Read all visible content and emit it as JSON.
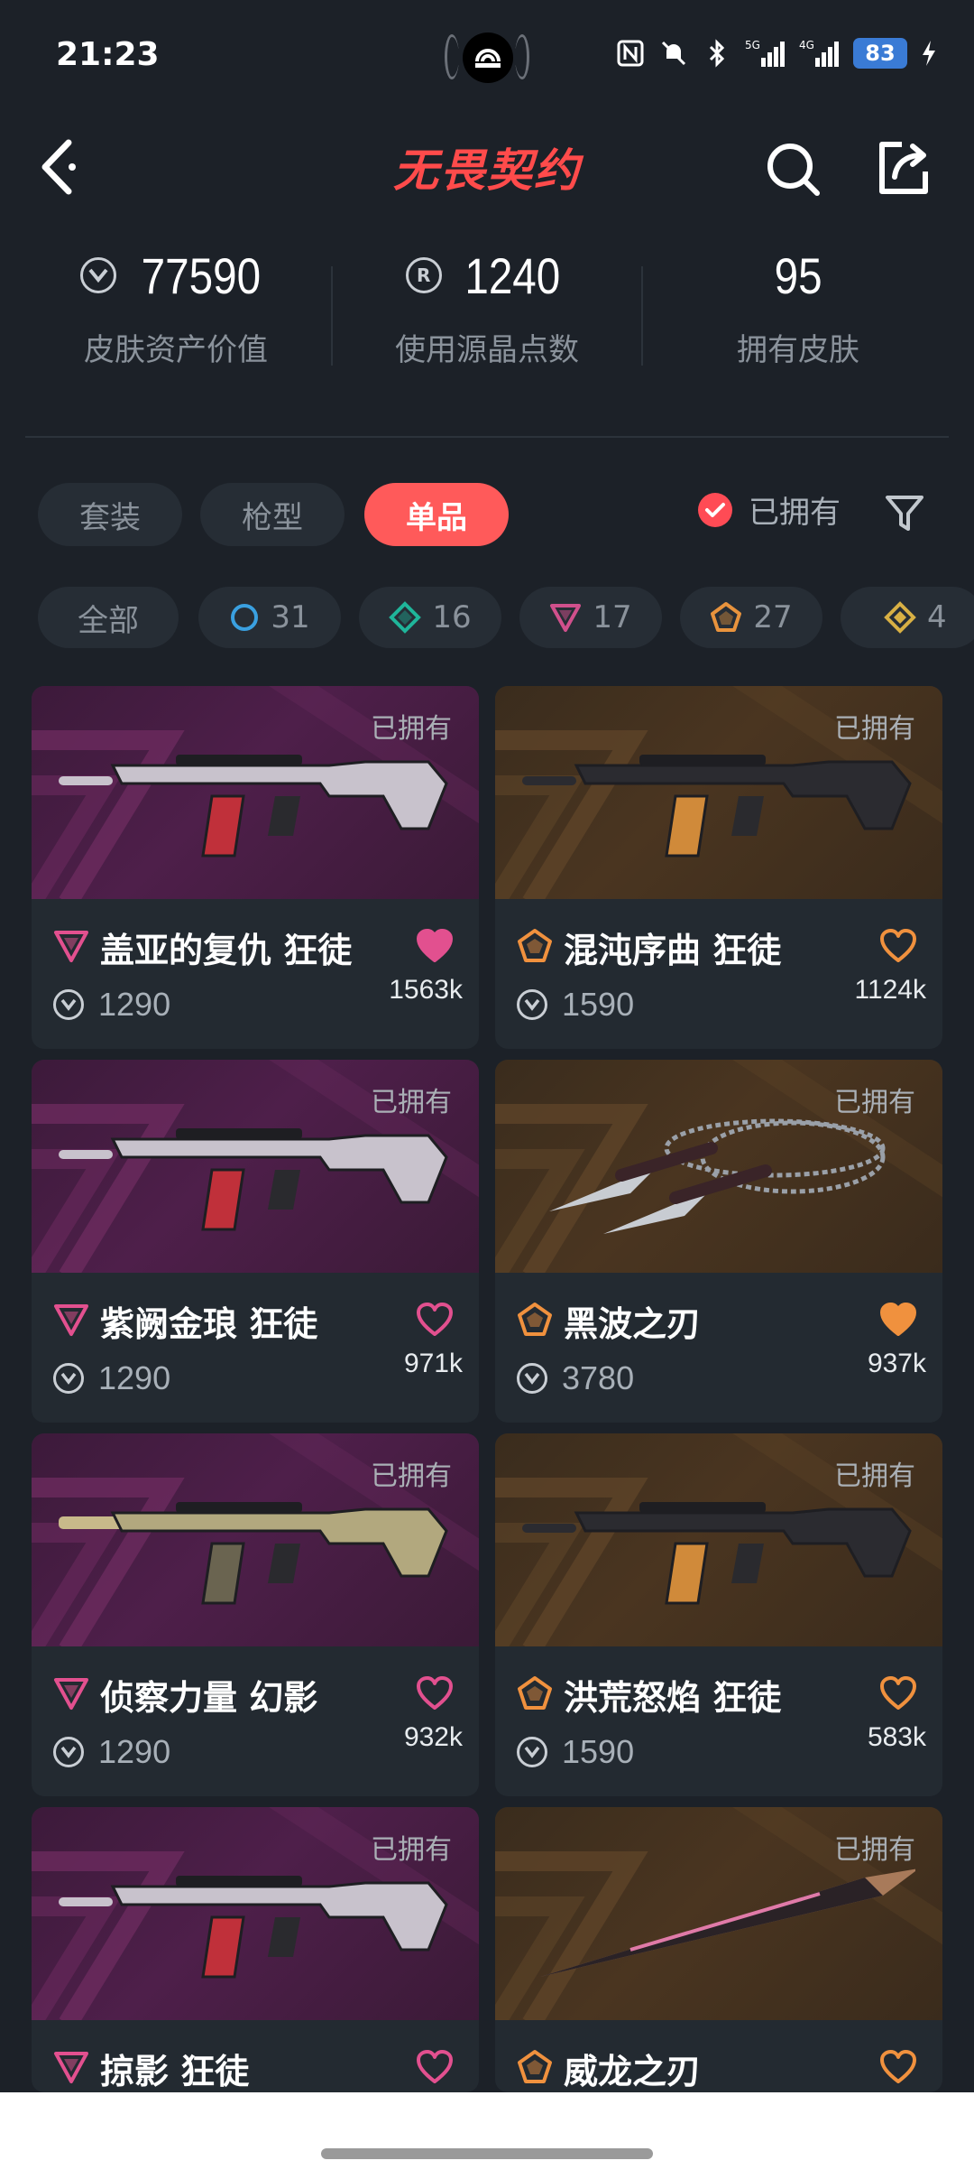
{
  "status_bar": {
    "time": "21:23",
    "battery": "83",
    "net_5g": "5G",
    "net_4g": "4G"
  },
  "header": {
    "logo_text": "无畏契约"
  },
  "stats": [
    {
      "value": "77590",
      "label": "皮肤资产价值",
      "icon": "vp-coin-icon"
    },
    {
      "value": "1240",
      "label": "使用源晶点数",
      "icon": "radianite-icon"
    },
    {
      "value": "95",
      "label": "拥有皮肤",
      "icon": ""
    }
  ],
  "category_tabs": [
    {
      "label": "套装",
      "active": false
    },
    {
      "label": "枪型",
      "active": false
    },
    {
      "label": "单品",
      "active": true
    }
  ],
  "owned_filter": {
    "label": "已拥有",
    "checked": true
  },
  "tier_filters": [
    {
      "label": "全部",
      "icon": ""
    },
    {
      "label": "31",
      "icon": "select-tier-icon",
      "color": "#3aa0e0"
    },
    {
      "label": "16",
      "icon": "deluxe-tier-icon",
      "color": "#1fb59a"
    },
    {
      "label": "17",
      "icon": "premium-tier-icon",
      "color": "#d0508c"
    },
    {
      "label": "27",
      "icon": "ultra-tier-icon",
      "color": "#e8933d"
    },
    {
      "label": "4",
      "icon": "exclusive-tier-icon",
      "color": "#d8b044"
    }
  ],
  "colors": {
    "accent": "#ff5a5a",
    "premium": "#e2508f",
    "ultra": "#f0913e",
    "background": "#1c2128"
  },
  "cards": [
    {
      "owned_tag": "已拥有",
      "name": "盖亚的复仇 狂徒",
      "price": "1290",
      "likes": "1563k",
      "tier": "premium",
      "liked": true,
      "theme": "purple",
      "weapon": "vandal"
    },
    {
      "owned_tag": "已拥有",
      "name": "混沌序曲 狂徒",
      "price": "1590",
      "likes": "1124k",
      "tier": "ultra",
      "liked": false,
      "theme": "orange",
      "weapon": "vandal"
    },
    {
      "owned_tag": "已拥有",
      "name": "紫阙金琅 狂徒",
      "price": "1290",
      "likes": "971k",
      "tier": "premium",
      "liked": false,
      "theme": "purple",
      "weapon": "vandal"
    },
    {
      "owned_tag": "已拥有",
      "name": "黑波之刃",
      "price": "3780",
      "likes": "937k",
      "tier": "ultra",
      "liked": true,
      "theme": "orange",
      "weapon": "kunai"
    },
    {
      "owned_tag": "已拥有",
      "name": "侦察力量 幻影",
      "price": "1290",
      "likes": "932k",
      "tier": "premium",
      "liked": false,
      "theme": "purple",
      "weapon": "phantom"
    },
    {
      "owned_tag": "已拥有",
      "name": "洪荒怒焰 狂徒",
      "price": "1590",
      "likes": "583k",
      "tier": "ultra",
      "liked": false,
      "theme": "orange",
      "weapon": "vandal"
    },
    {
      "owned_tag": "已拥有",
      "name": "掠影 狂徒",
      "price": "",
      "likes": "",
      "tier": "premium",
      "liked": false,
      "theme": "purple",
      "weapon": "vandal"
    },
    {
      "owned_tag": "已拥有",
      "name": "威龙之刃",
      "price": "",
      "likes": "",
      "tier": "ultra",
      "liked": false,
      "theme": "orange",
      "weapon": "blade"
    }
  ]
}
